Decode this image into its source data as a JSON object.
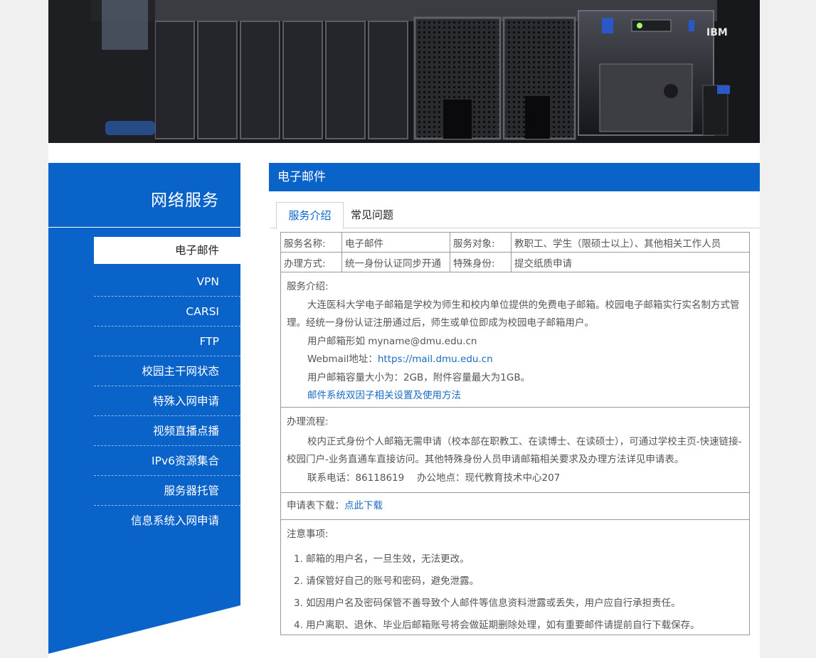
{
  "sidebar": {
    "title": "网络服务",
    "items": [
      {
        "label": "电子邮件",
        "active": true
      },
      {
        "label": "VPN"
      },
      {
        "label": "CARSI"
      },
      {
        "label": "FTP"
      },
      {
        "label": "校园主干网状态"
      },
      {
        "label": "特殊入网申请"
      },
      {
        "label": "视频直播点播"
      },
      {
        "label": "IPv6资源集合"
      },
      {
        "label": "服务器托管"
      },
      {
        "label": "信息系统入网申请"
      }
    ]
  },
  "main": {
    "title": "电子邮件",
    "tabs": [
      {
        "label": "服务介绍",
        "active": true
      },
      {
        "label": "常见问题"
      }
    ],
    "info_table": {
      "row1": {
        "k1": "服务名称:",
        "v1": "电子邮件",
        "k2": "服务对象:",
        "v2": "教职工、学生（限硕士以上）、其他相关工作人员"
      },
      "row2": {
        "k1": "办理方式:",
        "v1": "统一身份认证同步开通",
        "k2": "特殊身份:",
        "v2": "提交纸质申请"
      }
    },
    "intro": {
      "title": "服务介绍:",
      "para": "大连医科大学电子邮箱是学校为师生和校内单位提供的免费电子邮箱。校园电子邮箱实行实名制方式管理。经统一身份认证注册通过后，师生或单位即成为校园电子邮箱用户。",
      "format": "用户邮箱形如 myname@dmu.edu.cn",
      "webmail_label": "Webmail地址：",
      "webmail_link": "https://mail.dmu.edu.cn",
      "capacity": "用户邮箱容量大小为：2GB，附件容量最大为1GB。",
      "twofactor_link": "邮件系统双因子相关设置及使用方法"
    },
    "process": {
      "title": "办理流程:",
      "para": "校内正式身份个人邮箱无需申请（校本部在职教工、在读博士、在读硕士），可通过学校主页-快速链接-校园门户-业务直通车直接访问。其他特殊身份人员申请邮箱相关要求及办理方法详见申请表。",
      "contact": "联系电话：86118619　 办公地点：现代教育技术中心207"
    },
    "download": {
      "label": "申请表下载：",
      "link": "点此下载"
    },
    "notes": {
      "title": "注意事项:",
      "items": [
        "1.  邮箱的用户名，一旦生效，无法更改。",
        "2.  请保管好自己的账号和密码，避免泄露。",
        "3.  如因用户名及密码保管不善导致个人邮件等信息资料泄露或丢失，用户应自行承担责任。",
        "4.  用户离职、退休、毕业后邮箱账号将会做延期删除处理，如有重要邮件请提前自行下载保存。"
      ]
    }
  },
  "colors": {
    "brand_blue": "#0a63c9",
    "link": "#1a6bc2"
  }
}
